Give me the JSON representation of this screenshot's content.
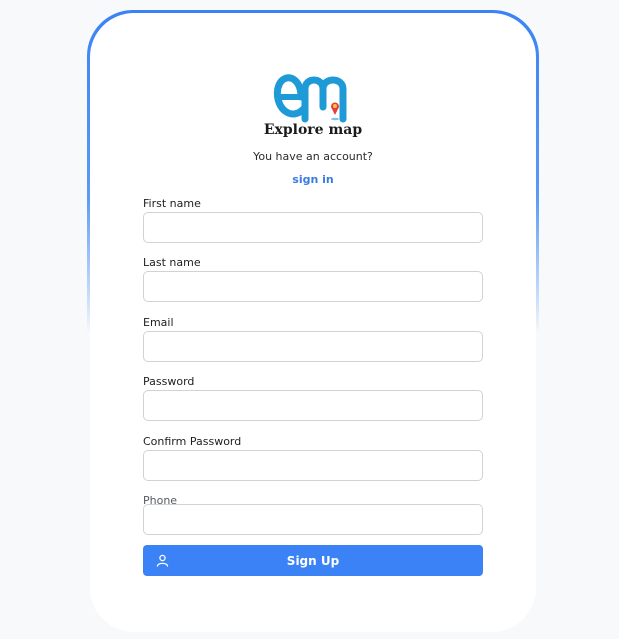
{
  "brand": {
    "name": "Explore map"
  },
  "signin_prompt": {
    "text": "You have an account?",
    "link": "sign in"
  },
  "form": {
    "fields": [
      {
        "label": "First name",
        "value": "",
        "placeholder": ""
      },
      {
        "label": "Last name",
        "value": "",
        "placeholder": ""
      },
      {
        "label": "Email",
        "value": "",
        "placeholder": ""
      },
      {
        "label": "Password",
        "value": "",
        "placeholder": ""
      },
      {
        "label": "Confirm Password",
        "value": "",
        "placeholder": ""
      },
      {
        "label": "Phone",
        "value": "",
        "placeholder": ""
      }
    ],
    "submit_label": "Sign Up",
    "submit_icon": "user-icon"
  },
  "colors": {
    "accent": "#3b82f6",
    "link": "#3b7be0",
    "logo_blue": "#1e9ad6"
  }
}
